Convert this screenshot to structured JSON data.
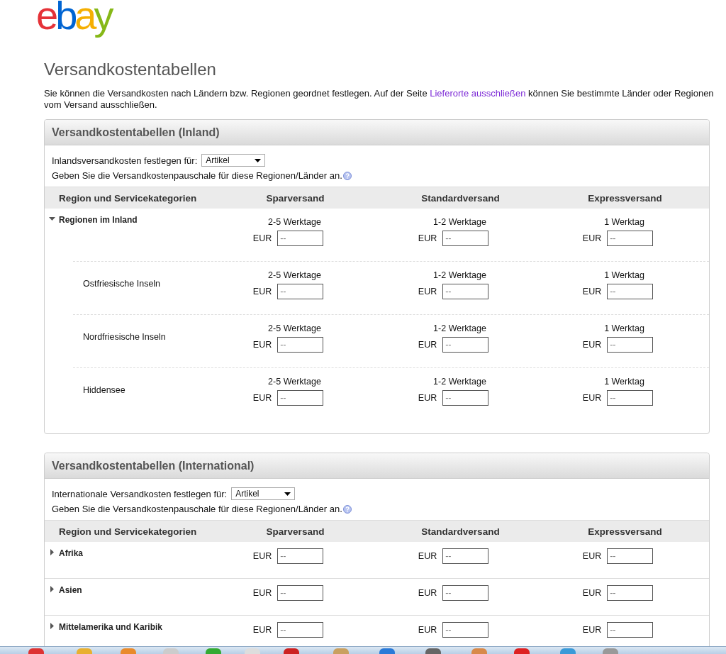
{
  "logo": [
    {
      "text": "e",
      "color": "#e53238"
    },
    {
      "text": "b",
      "color": "#0064d2"
    },
    {
      "text": "a",
      "color": "#f5af02"
    },
    {
      "text": "y",
      "color": "#86b817"
    }
  ],
  "title": "Versandkostentabellen",
  "intro": {
    "before": "Sie können die Versandkosten nach Ländern bzw. Regionen geordnet festlegen. Auf der Seite",
    "link": "Lieferorte ausschließen",
    "after": "können Sie bestimmte Länder oder Regionen vom Versand ausschließen."
  },
  "sections": [
    {
      "title": "Versandkostentabellen (Inland)",
      "setting_label": "Inlandsversandkosten festlegen für:",
      "setting_value": "Artikel",
      "hint": "Geben Sie die Versandkostenpauschale für diese Regionen/Länder an.",
      "region_header": "Region und Servicekategorien",
      "columns": [
        "Sparversand",
        "Standardversand",
        "Expressversand"
      ],
      "rows": [
        {
          "kind": "group",
          "name": "Regionen im Inland",
          "expanded": true,
          "cells": [
            {
              "time": "2-5 Werktage",
              "currency": "EUR",
              "placeholder": "--"
            },
            {
              "time": "1-2 Werktage",
              "currency": "EUR",
              "placeholder": "--"
            },
            {
              "time": "1 Werktag",
              "currency": "EUR",
              "placeholder": "--"
            }
          ]
        },
        {
          "kind": "sub",
          "name": "Ostfriesische Inseln",
          "cells": [
            {
              "time": "2-5 Werktage",
              "currency": "EUR",
              "placeholder": "--"
            },
            {
              "time": "1-2 Werktage",
              "currency": "EUR",
              "placeholder": "--"
            },
            {
              "time": "1 Werktag",
              "currency": "EUR",
              "placeholder": "--"
            }
          ]
        },
        {
          "kind": "sub",
          "name": "Nordfriesische Inseln",
          "cells": [
            {
              "time": "2-5 Werktage",
              "currency": "EUR",
              "placeholder": "--"
            },
            {
              "time": "1-2 Werktage",
              "currency": "EUR",
              "placeholder": "--"
            },
            {
              "time": "1 Werktag",
              "currency": "EUR",
              "placeholder": "--"
            }
          ]
        },
        {
          "kind": "sub",
          "name": "Hiddensee",
          "cells": [
            {
              "time": "2-5 Werktage",
              "currency": "EUR",
              "placeholder": "--"
            },
            {
              "time": "1-2 Werktage",
              "currency": "EUR",
              "placeholder": "--"
            },
            {
              "time": "1 Werktag",
              "currency": "EUR",
              "placeholder": "--"
            }
          ]
        }
      ]
    },
    {
      "title": "Versandkostentabellen (International)",
      "setting_label": "Internationale Versandkosten festlegen für:",
      "setting_value": "Artikel",
      "hint": "Geben Sie die Versandkostenpauschale für diese Regionen/Länder an.",
      "region_header": "Region und Servicekategorien",
      "columns": [
        "Sparversand",
        "Standardversand",
        "Expressversand"
      ],
      "rows": [
        {
          "kind": "group",
          "name": "Afrika",
          "expanded": false,
          "cells": [
            {
              "currency": "EUR",
              "placeholder": "--"
            },
            {
              "currency": "EUR",
              "placeholder": "--"
            },
            {
              "currency": "EUR",
              "placeholder": "--"
            }
          ]
        },
        {
          "kind": "group",
          "name": "Asien",
          "expanded": false,
          "cells": [
            {
              "currency": "EUR",
              "placeholder": "--"
            },
            {
              "currency": "EUR",
              "placeholder": "--"
            },
            {
              "currency": "EUR",
              "placeholder": "--"
            }
          ]
        },
        {
          "kind": "group",
          "name": "Mittelamerika und Karibik",
          "expanded": false,
          "cells": [
            {
              "currency": "EUR",
              "placeholder": "--"
            },
            {
              "currency": "EUR",
              "placeholder": "--"
            },
            {
              "currency": "EUR",
              "placeholder": "--"
            }
          ]
        }
      ]
    }
  ]
}
